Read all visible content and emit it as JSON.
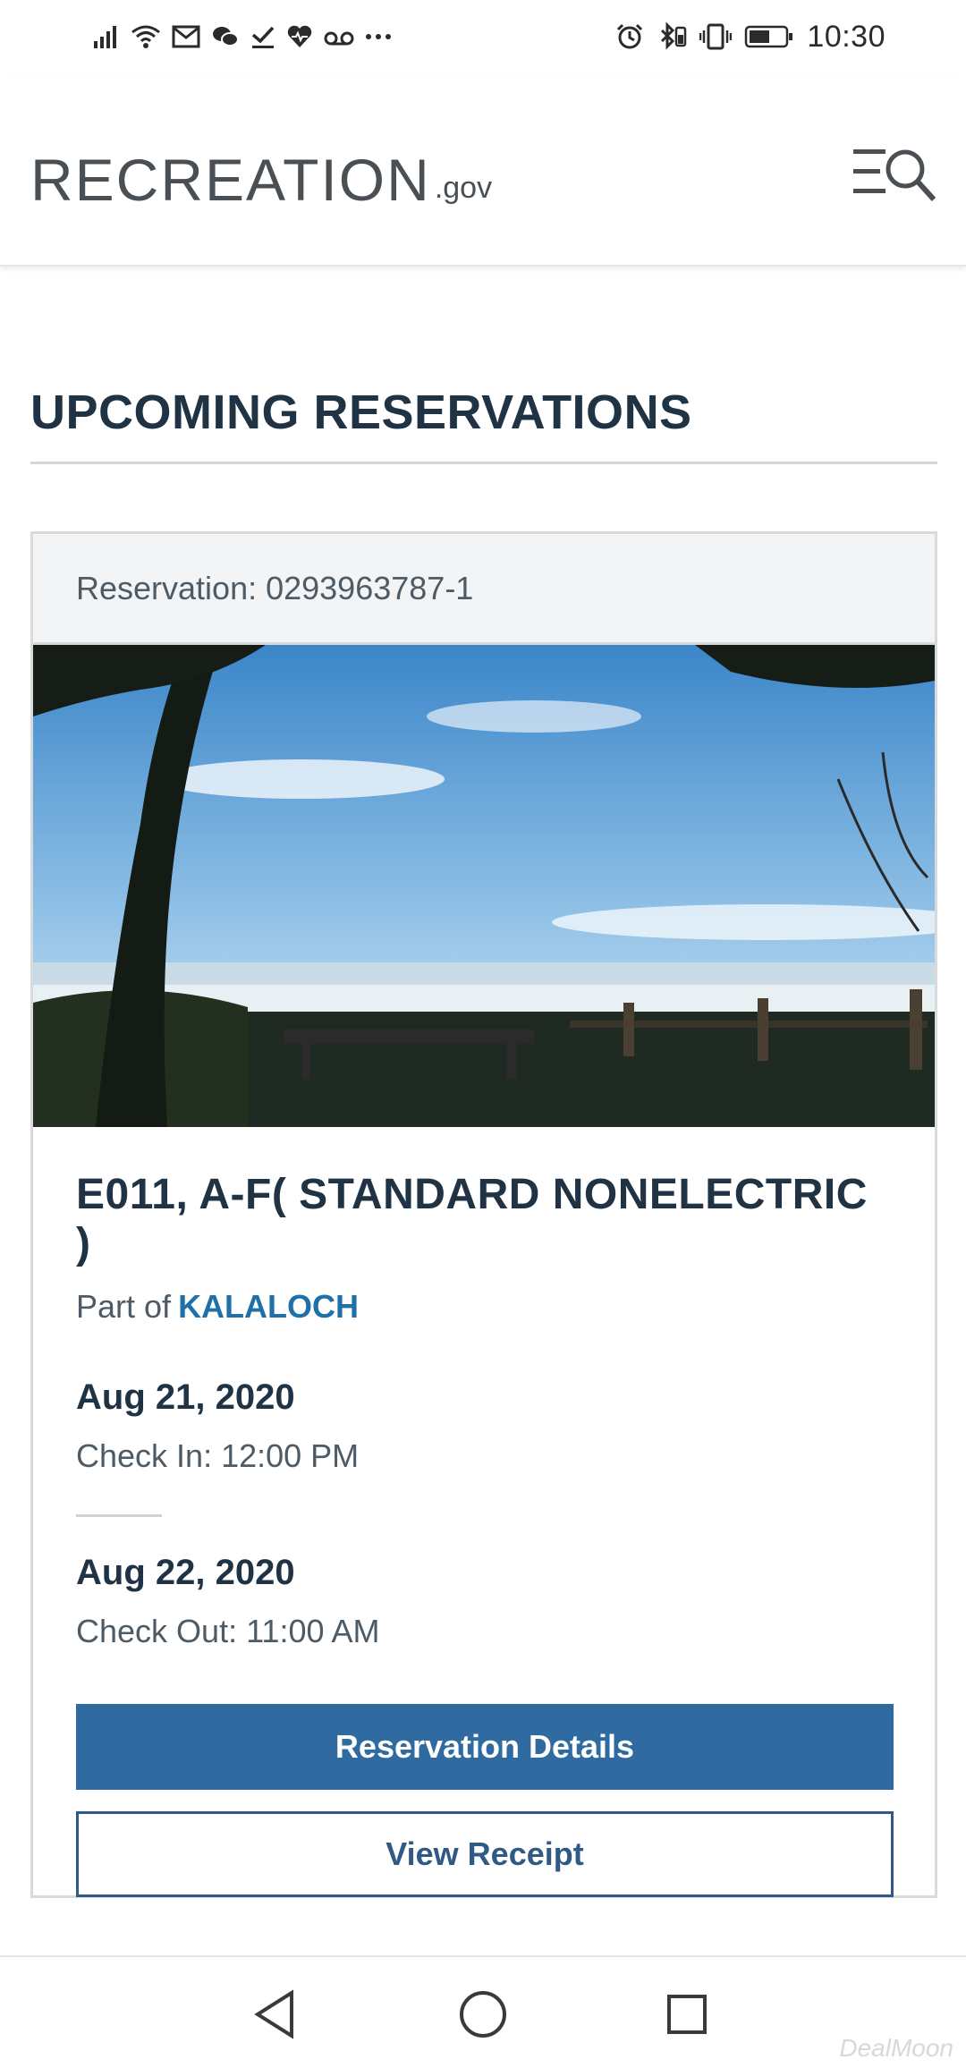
{
  "status_bar": {
    "time": "10:30",
    "left_icons": [
      "signal-icon",
      "wifi-icon",
      "mail-icon",
      "chat-icon",
      "check-icon",
      "heart-icon",
      "voicemail-icon",
      "more-icon"
    ],
    "right_icons": [
      "alarm-icon",
      "bluetooth-icon",
      "vibrate-icon",
      "battery-icon"
    ]
  },
  "header": {
    "logo_text": "RECREATION",
    "logo_suffix": ".gov",
    "menu_icon": "menu-search-icon"
  },
  "section": {
    "title": "UPCOMING RESERVATIONS"
  },
  "reservation": {
    "label": "Reservation: 0293963787-1",
    "image_icon": "campsite-photo",
    "site_name": "E011, A-F( STANDARD NONELECTRIC )",
    "part_of_prefix": "Part of",
    "part_of_link": "KALALOCH",
    "check_in_date": "Aug 21, 2020",
    "check_in_time": "Check In: 12:00 PM",
    "check_out_date": "Aug 22, 2020",
    "check_out_time": "Check Out: 11:00 AM",
    "details_button": "Reservation Details",
    "receipt_button": "View Receipt"
  },
  "nav_bar": {
    "back_icon": "back-triangle-icon",
    "home_icon": "home-circle-icon",
    "recents_icon": "recents-square-icon"
  },
  "watermark": "DealMoon",
  "colors": {
    "primary": "#2f6ba1",
    "link": "#1f6fa8",
    "heading": "#1f3344"
  }
}
